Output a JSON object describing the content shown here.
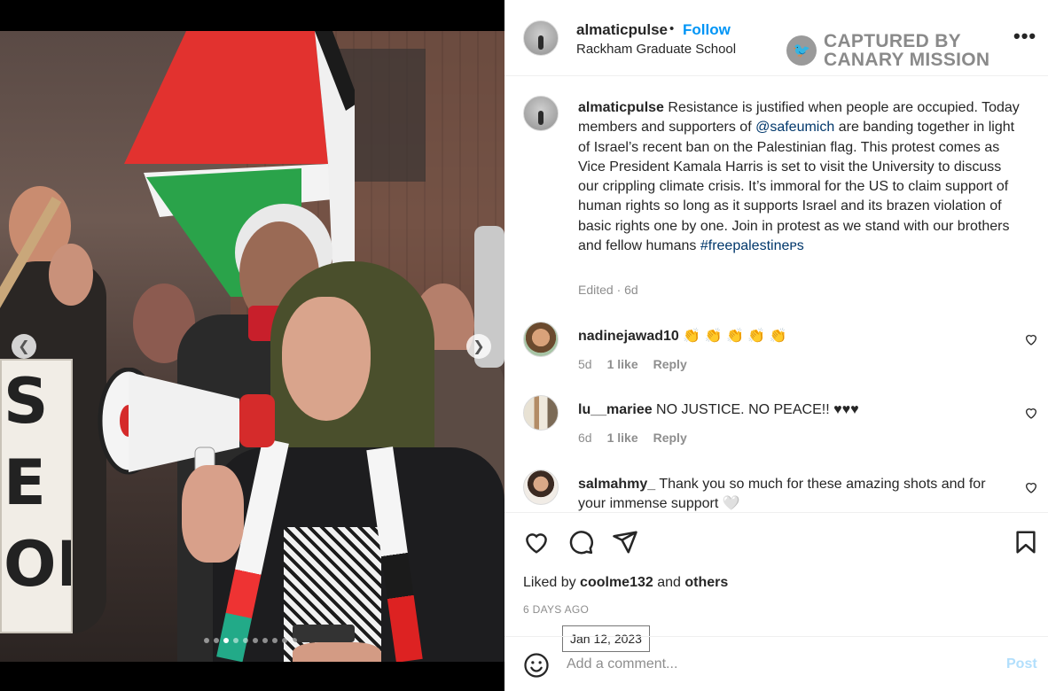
{
  "post": {
    "username": "almaticpulse",
    "separator": "•",
    "follow_label": "Follow",
    "location": "Rackham Graduate School",
    "more_icon": "more-horizontal-icon",
    "watermark": {
      "line1": "CAPTURED BY",
      "line2": "CANARY MISSION"
    }
  },
  "media": {
    "sign_text": "S\nE\nON",
    "carousel_dots": 10,
    "active_dot": 3
  },
  "caption": {
    "username": "almaticpulse",
    "text_part1": " Resistance is justified when people are occupied. Today members and supporters of ",
    "mention": "@safeumich",
    "text_part2": " are banding together in light of Israel’s recent ban on the Palestinian flag. This protest comes as Vice President Kamala Harris is set to visit the University to discuss our crippling climate crisis. It’s immoral for the US to claim support of human rights so long as it supports Israel and its brazen violation of basic rights one by one. Join in protest as we stand with our brothers and fellow humans ",
    "hashtag": "#freepalestineᴘs",
    "edited": "Edited · 6d"
  },
  "comments": [
    {
      "username": "nadinejawad10",
      "text": " 👏 👏 👏 👏 👏",
      "age": "5d",
      "likes": "1 like",
      "reply": "Reply"
    },
    {
      "username": "lu__mariee",
      "text": " NO JUSTICE. NO PEACE!! ♥♥♥",
      "age": "6d",
      "likes": "1 like",
      "reply": "Reply"
    },
    {
      "username": "salmahmy_",
      "text": " Thank you so much for these amazing shots and for your immense support 🤍",
      "age": "",
      "likes": "",
      "reply": ""
    }
  ],
  "actions": {
    "liked_by_prefix": "Liked by ",
    "liked_by_user": "coolme132",
    "liked_by_and": " and ",
    "liked_by_others": "others",
    "time_ago": "6 DAYS AGO",
    "tooltip_date": "Jan 12, 2023"
  },
  "add_comment": {
    "placeholder": "Add a comment...",
    "post_label": "Post"
  },
  "colors": {
    "link_blue": "#0095f6",
    "mention_blue": "#00376b",
    "muted": "#8e8e8e",
    "post_disabled": "#b2dffc"
  }
}
